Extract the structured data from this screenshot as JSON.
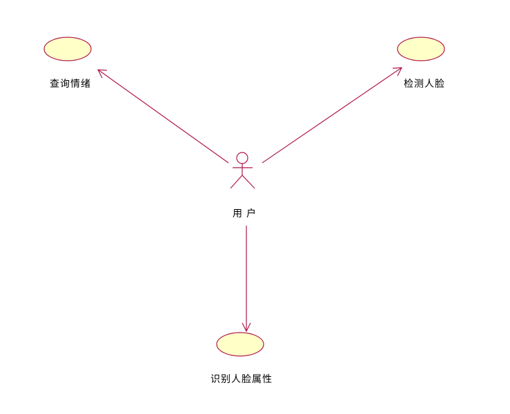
{
  "diagram": {
    "type": "use-case",
    "colors": {
      "line": "#b0174a",
      "usecase_fill": "#ffffc8",
      "usecase_stroke": "#b0174a",
      "text": "#000000"
    },
    "actor": {
      "id": "user",
      "label": "用户"
    },
    "use_cases": [
      {
        "id": "query-emotion",
        "label": "查询情绪"
      },
      {
        "id": "detect-face",
        "label": "检测人脸"
      },
      {
        "id": "identify-face-attributes",
        "label": "识别人脸属性"
      }
    ],
    "associations": [
      {
        "from": "user",
        "to": "query-emotion",
        "directed": true
      },
      {
        "from": "user",
        "to": "detect-face",
        "directed": true
      },
      {
        "from": "user",
        "to": "identify-face-attributes",
        "directed": true
      }
    ]
  }
}
